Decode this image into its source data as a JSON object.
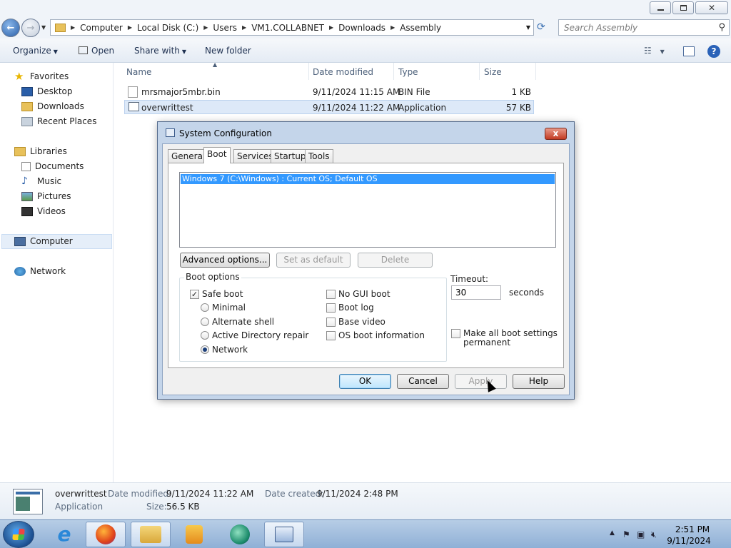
{
  "explorer": {
    "breadcrumbs": [
      "Computer",
      "Local Disk (C:)",
      "Users",
      "VM1.COLLABNET",
      "Downloads",
      "Assembly"
    ],
    "search_placeholder": "Search Assembly",
    "commands": {
      "organize": "Organize",
      "open": "Open",
      "share_with": "Share with",
      "new_folder": "New folder"
    },
    "nav": {
      "favorites": "Favorites",
      "desktop": "Desktop",
      "downloads": "Downloads",
      "recent_places": "Recent Places",
      "libraries": "Libraries",
      "documents": "Documents",
      "music": "Music",
      "pictures": "Pictures",
      "videos": "Videos",
      "computer": "Computer",
      "network": "Network"
    },
    "columns": {
      "name": "Name",
      "date_modified": "Date modified",
      "type": "Type",
      "size": "Size"
    },
    "files": [
      {
        "name": "mrsmajor5mbr.bin",
        "date": "9/11/2024 11:15 AM",
        "type": "BIN File",
        "size": "1 KB"
      },
      {
        "name": "overwrittest",
        "date": "9/11/2024 11:22 AM",
        "type": "Application",
        "size": "57 KB"
      }
    ],
    "details": {
      "name": "overwrittest",
      "type": "Application",
      "date_modified_label": "Date modified:",
      "date_modified": "9/11/2024 11:22 AM",
      "date_created_label": "Date created:",
      "date_created": "9/11/2024 2:48 PM",
      "size_label": "Size:",
      "size": "56.5 KB"
    }
  },
  "dialog": {
    "title": "System Configuration",
    "close": "x",
    "tabs": [
      "General",
      "Boot",
      "Services",
      "Startup",
      "Tools"
    ],
    "os_entry": "Windows 7 (C:\\Windows) : Current OS; Default OS",
    "buttons": {
      "advanced": "Advanced options...",
      "set_default": "Set as default",
      "delete": "Delete",
      "ok": "OK",
      "cancel": "Cancel",
      "apply": "Apply",
      "help": "Help"
    },
    "boot_options_label": "Boot options",
    "safe_boot": "Safe boot",
    "minimal": "Minimal",
    "alternate_shell": "Alternate shell",
    "ad_repair": "Active Directory repair",
    "network": "Network",
    "no_gui_boot": "No GUI boot",
    "boot_log": "Boot log",
    "base_video": "Base video",
    "os_boot_info": "OS boot information",
    "timeout_label": "Timeout:",
    "timeout_value": "30",
    "timeout_unit": "seconds",
    "make_permanent_1": "Make all boot settings",
    "make_permanent_2": "permanent"
  },
  "taskbar": {
    "time": "2:51 PM",
    "date": "9/11/2024"
  }
}
